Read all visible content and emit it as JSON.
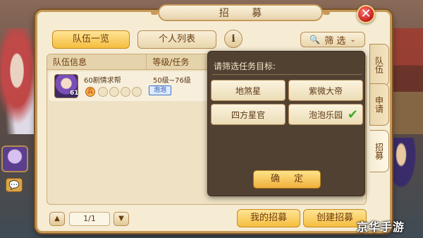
{
  "dialog": {
    "title": "招 募"
  },
  "tabs": {
    "team_list": "队伍一览",
    "personal_list": "个人列表",
    "info": "i"
  },
  "filter": {
    "label": "筛 选",
    "icon": "search-icon"
  },
  "side_tabs": [
    "队伍",
    "申请",
    "招募"
  ],
  "table": {
    "headers": [
      "队伍信息",
      "等级/任务",
      ""
    ],
    "rows": [
      {
        "level": "61",
        "name": "60剧情求帮",
        "badge": "兵",
        "level_range": "50级~76级",
        "task": "泡泡"
      }
    ]
  },
  "popup": {
    "title": "请筛选任务目标:",
    "options": [
      "地煞星",
      "紫微大帝",
      "四方星官",
      "泡泡乐园"
    ],
    "selected_index": 3,
    "confirm": "确 定"
  },
  "pagination": {
    "page": "1/1"
  },
  "bottom": {
    "my_recruit": "我的招募",
    "create_recruit": "创建招募"
  },
  "watermark": "京华手游",
  "colors": {
    "accent_gold": "#f5bd3f",
    "close_red": "#c21d1d",
    "check_green": "#3fae2a",
    "popup_bg": "#4a3a2c"
  }
}
